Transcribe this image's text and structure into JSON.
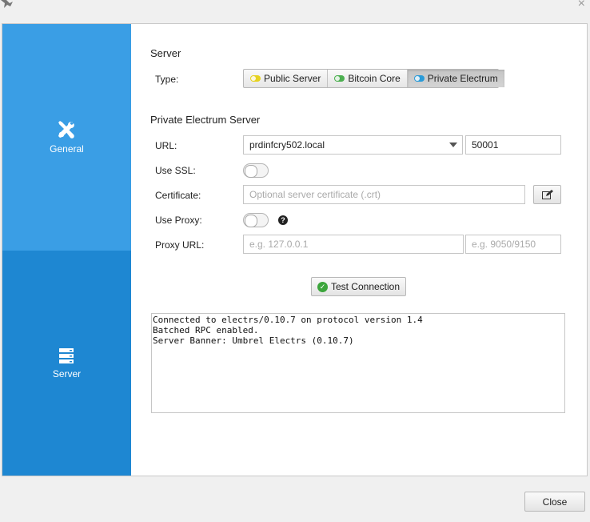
{
  "window": {
    "close_glyph": "×"
  },
  "sidebar": {
    "items": [
      {
        "label": "General",
        "icon": "tools-icon"
      },
      {
        "label": "Server",
        "icon": "server-icon"
      }
    ]
  },
  "server": {
    "section_title": "Server",
    "type_label": "Type:",
    "types": [
      {
        "label": "Public Server",
        "color": "#e6d21f",
        "active": false
      },
      {
        "label": "Bitcoin Core",
        "color": "#4caf50",
        "active": false
      },
      {
        "label": "Private Electrum",
        "color": "#2a9bd8",
        "active": true
      }
    ]
  },
  "private_server": {
    "section_title": "Private Electrum Server",
    "url_label": "URL:",
    "url_value": "prdinfcry502.local",
    "port_value": "50001",
    "ssl_label": "Use SSL:",
    "certificate_label": "Certificate:",
    "certificate_placeholder": "Optional server certificate (.crt)",
    "proxy_label": "Use Proxy:",
    "proxy_url_label": "Proxy URL:",
    "proxy_host_placeholder": "e.g. 127.0.0.1",
    "proxy_port_placeholder": "e.g. 9050/9150"
  },
  "test_button": {
    "label": "Test Connection"
  },
  "log": {
    "lines": [
      "Connected to electrs/0.10.7 on protocol version 1.4",
      "Batched RPC enabled.",
      "Server Banner: Umbrel Electrs (0.10.7)"
    ]
  },
  "footer": {
    "close_label": "Close"
  }
}
